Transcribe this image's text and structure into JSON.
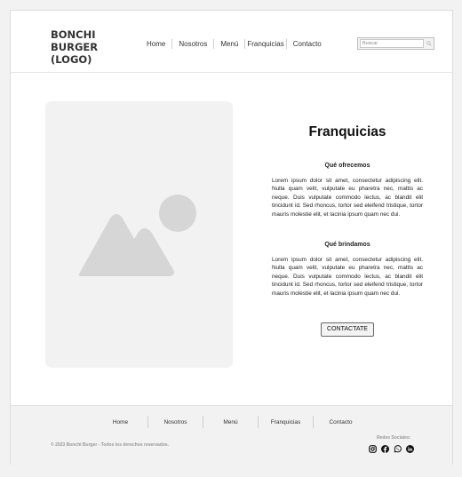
{
  "header": {
    "logo_lines": [
      "BONCHI",
      "BURGER",
      "(LOGO)"
    ],
    "nav": [
      "Home",
      "Nosotros",
      "Menú",
      "Franquicias",
      "Contacto"
    ],
    "search": {
      "placeholder": "Buscar",
      "value": ""
    }
  },
  "main": {
    "image_placeholder_icon": "image-placeholder-icon",
    "title": "Franquicias",
    "section1": {
      "subtitle": "Qué ofrecemos",
      "text": "Lorem ipsum dolor sit amet, consectetur adipiscing elit. Nulla quam velit, vulputate eu pharetra nec, mattis ac neque. Duis vulputate commodo lectus, ac blandit elit tincidunt id. Sed rhoncus, tortor sed eleifend tristique, tortor mauris molestie elit, et lacinia ipsum quam nec dui."
    },
    "section2": {
      "subtitle": "Qué brindamos",
      "text": "Lorem ipsum dolor sit amet, consectetur adipiscing elit. Nulla quam velit, vulputate eu pharetra nec, mattis ac neque. Duis vulputate commodo lectus, ac blandit elit tincidunt id. Sed rhoncus, tortor sed eleifend tristique, tortor mauris molestie elit, et lacinia ipsum quam nec dui."
    },
    "cta_label": "CONTACTATE"
  },
  "footer": {
    "nav": [
      "Home",
      "Nosotros",
      "Menú",
      "Franquicias",
      "Contacto"
    ],
    "copyright": "© 2023 Bonchi Burger - Todos los derechos reservados.",
    "social_label": "Redes Sociales:",
    "social_icons": [
      "instagram-icon",
      "facebook-icon",
      "whatsapp-icon",
      "linkedin-icon"
    ]
  },
  "colors": {
    "page_bg": "#f2f2f2",
    "panel_bg": "#ffffff",
    "placeholder_bg": "#f2f2f2",
    "placeholder_shape": "#d6d6d6",
    "footer_bg": "#f2f2f2"
  }
}
